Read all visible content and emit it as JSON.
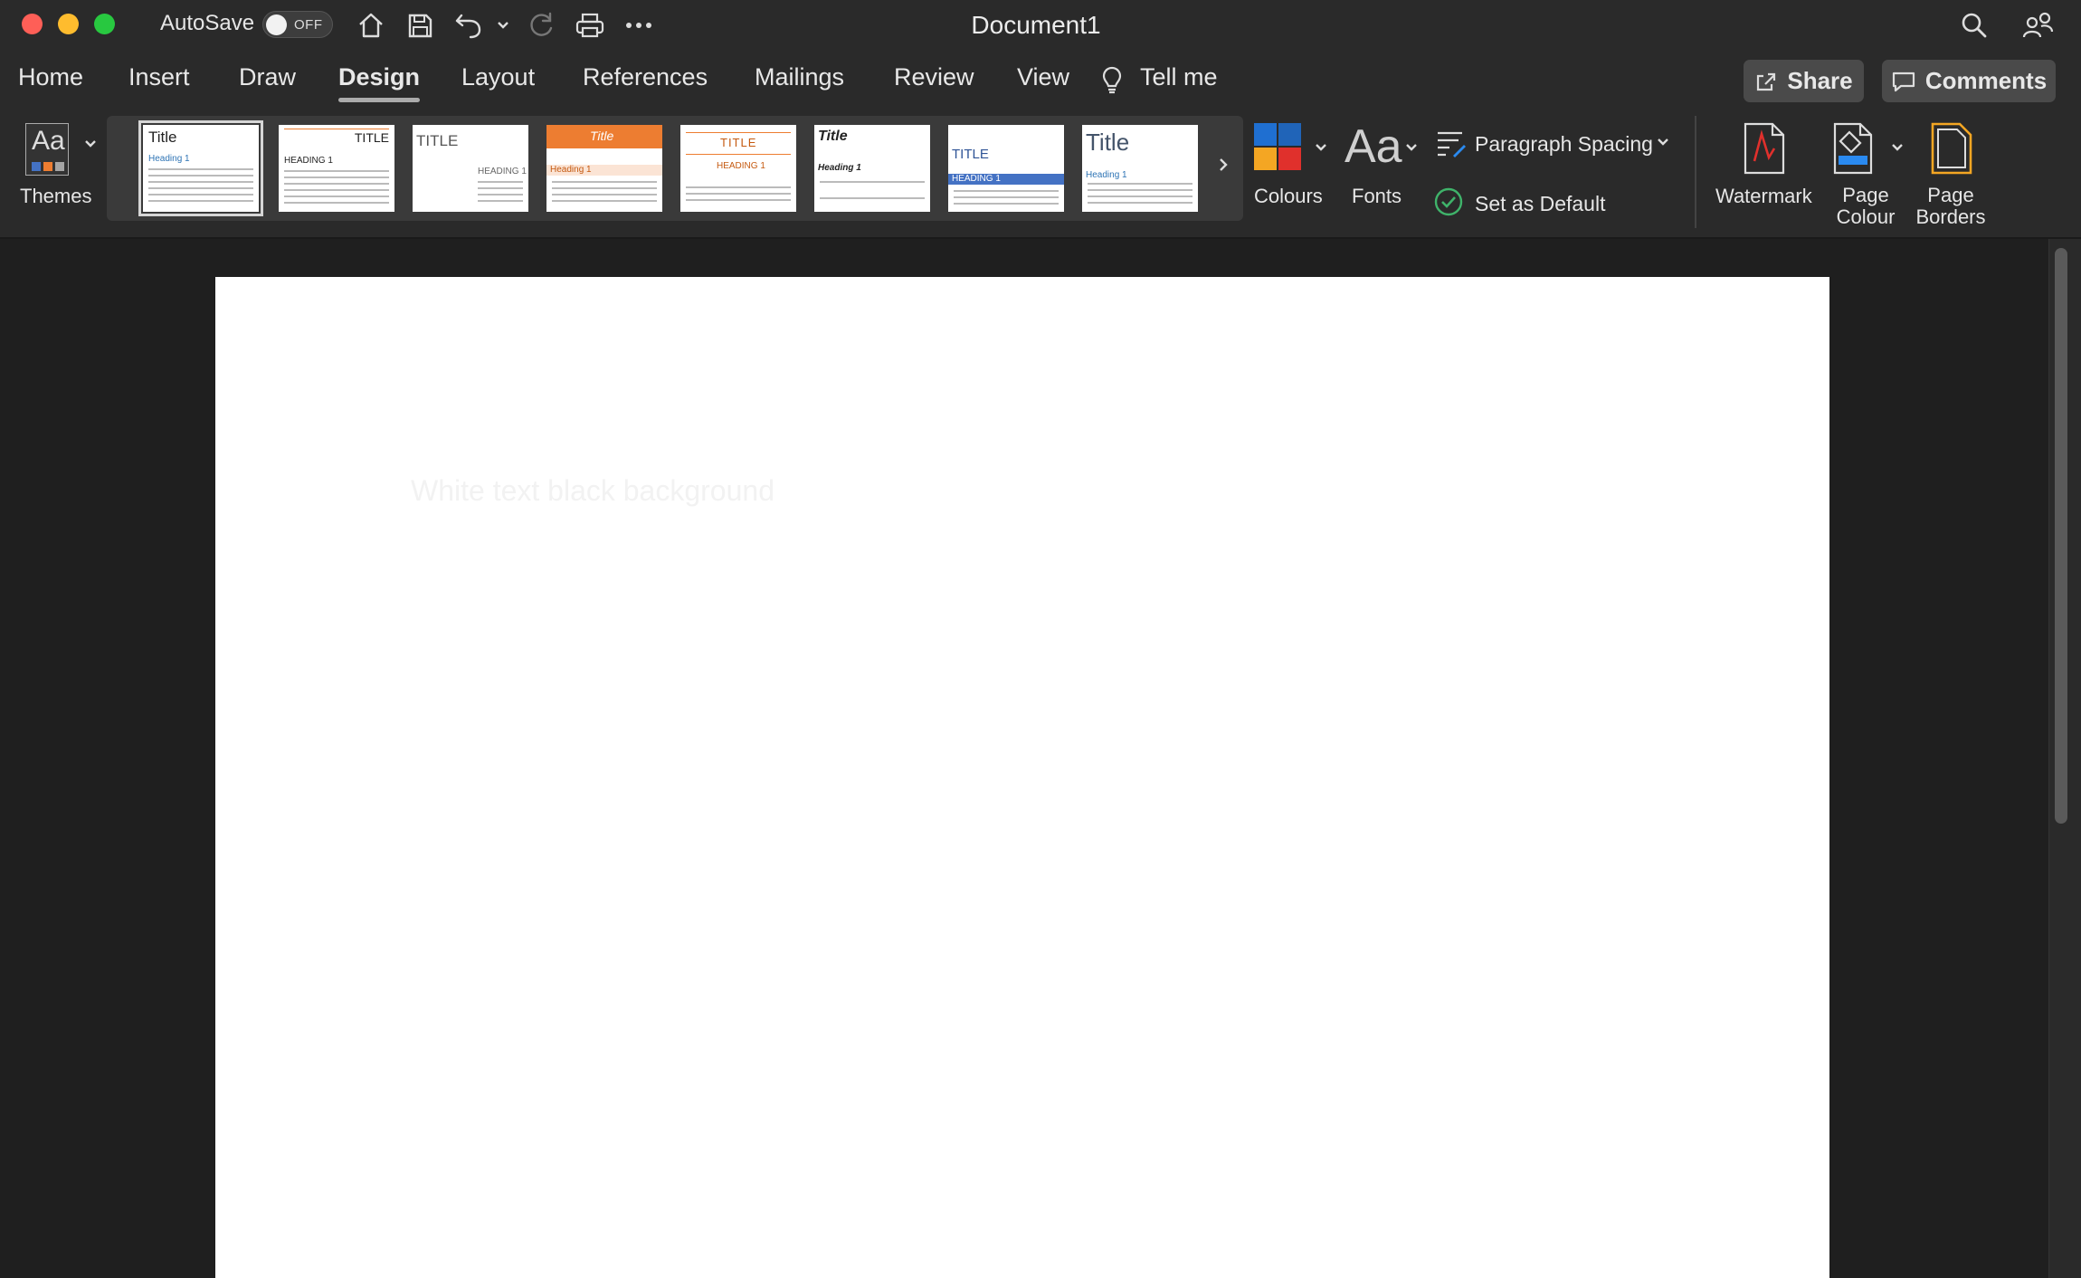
{
  "titlebar": {
    "autosave_label": "AutoSave",
    "autosave_state": "OFF",
    "document_title": "Document1",
    "quick_access": [
      "home-icon",
      "save-icon",
      "undo-icon",
      "redo-icon",
      "print-icon",
      "more-icon"
    ]
  },
  "tabs": [
    {
      "label": "Home",
      "active": false
    },
    {
      "label": "Insert",
      "active": false
    },
    {
      "label": "Draw",
      "active": false
    },
    {
      "label": "Design",
      "active": true
    },
    {
      "label": "Layout",
      "active": false
    },
    {
      "label": "References",
      "active": false
    },
    {
      "label": "Mailings",
      "active": false
    },
    {
      "label": "Review",
      "active": false
    },
    {
      "label": "View",
      "active": false
    }
  ],
  "tell_me": "Tell me",
  "share_label": "Share",
  "comments_label": "Comments",
  "ribbon": {
    "themes_label": "Themes",
    "themes_glyph": "Aa",
    "gallery": [
      {
        "title": "Title",
        "heading": "Heading 1",
        "selected": true
      },
      {
        "title": "TITLE",
        "heading": "HEADING 1",
        "selected": false
      },
      {
        "title": "TITLE",
        "heading": "HEADING 1",
        "selected": false
      },
      {
        "title": "Title",
        "heading": "Heading 1",
        "selected": false
      },
      {
        "title": "TITLE",
        "heading": "HEADING 1",
        "selected": false
      },
      {
        "title": "Title",
        "heading": "Heading 1",
        "selected": false
      },
      {
        "title": "TITLE",
        "heading": "HEADING 1",
        "selected": false
      },
      {
        "title": "Title",
        "heading": "Heading 1",
        "selected": false
      }
    ],
    "colours_label": "Colours",
    "fonts_label": "Fonts",
    "fonts_glyph": "Aa",
    "paragraph_spacing_label": "Paragraph Spacing",
    "set_default_label": "Set as Default",
    "watermark_label": "Watermark",
    "page_colour_label": "Page Colour",
    "page_borders_label": "Page Borders"
  },
  "document": {
    "body_text": "White text black background"
  },
  "colors": {
    "accent_orange": "#ed7d31",
    "accent_blue": "#4472c4",
    "watermark_red": "#e0302c",
    "set_default_green": "#3fb36a"
  }
}
